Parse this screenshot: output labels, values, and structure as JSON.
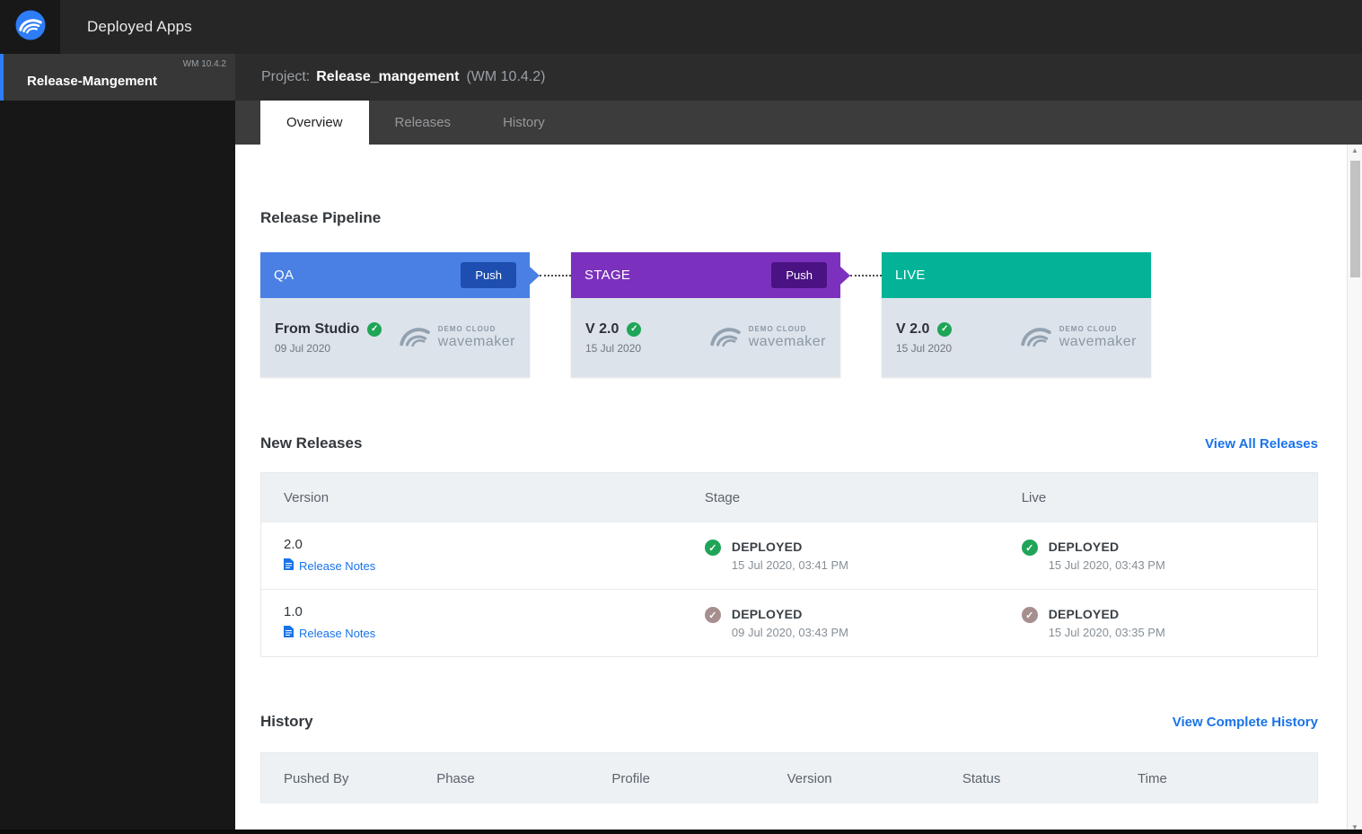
{
  "topbar": {
    "title": "Deployed Apps"
  },
  "sidebar": {
    "items": [
      {
        "label": "Release-Mangement",
        "version": "WM 10.4.2"
      }
    ]
  },
  "project_header": {
    "prefix": "Project:",
    "name": "Release_mangement",
    "version": "(WM 10.4.2)"
  },
  "tabs": [
    {
      "label": "Overview",
      "active": true
    },
    {
      "label": "Releases",
      "active": false
    },
    {
      "label": "History",
      "active": false
    }
  ],
  "pipeline": {
    "title": "Release Pipeline",
    "logo_top": "DEMO CLOUD",
    "logo_bottom": "wavemaker",
    "stages": [
      {
        "name": "QA",
        "push": "Push",
        "version": "From Studio",
        "date": "09 Jul 2020",
        "color": "#4a80e4",
        "push_color": "#1d4eb0"
      },
      {
        "name": "STAGE",
        "push": "Push",
        "version": "V 2.0",
        "date": "15 Jul 2020",
        "color": "#7b31bd",
        "push_color": "#4a1283"
      },
      {
        "name": "LIVE",
        "version": "V 2.0",
        "date": "15 Jul 2020",
        "color": "#02b397"
      }
    ]
  },
  "new_releases": {
    "title": "New Releases",
    "link": "View All Releases",
    "columns": [
      "Version",
      "Stage",
      "Live"
    ],
    "rows": [
      {
        "version": "2.0",
        "notes_label": "Release Notes",
        "stage": {
          "status": "DEPLOYED",
          "time": "15 Jul 2020, 03:41 PM",
          "check": "green"
        },
        "live": {
          "status": "DEPLOYED",
          "time": "15 Jul 2020, 03:43 PM",
          "check": "green"
        }
      },
      {
        "version": "1.0",
        "notes_label": "Release Notes",
        "stage": {
          "status": "DEPLOYED",
          "time": "09 Jul 2020, 03:43 PM",
          "check": "muted"
        },
        "live": {
          "status": "DEPLOYED",
          "time": "15 Jul 2020, 03:35 PM",
          "check": "muted"
        }
      }
    ]
  },
  "history": {
    "title": "History",
    "link": "View Complete History",
    "columns": [
      "Pushed By",
      "Phase",
      "Profile",
      "Version",
      "Status",
      "Time"
    ]
  },
  "colors": {
    "accent_link": "#1a73e8",
    "check_green": "#1fa557",
    "check_muted": "#a78f90"
  }
}
